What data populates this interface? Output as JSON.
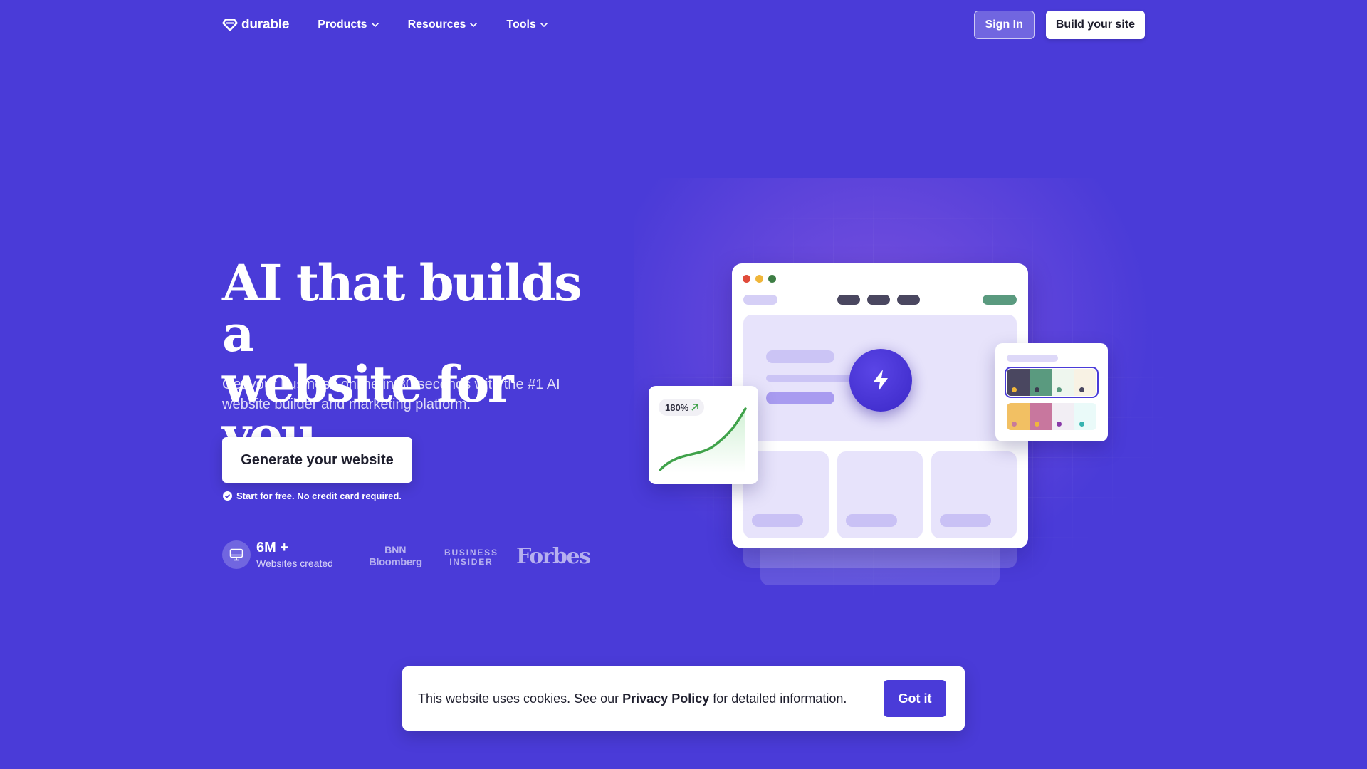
{
  "nav": {
    "logo_text": "durable",
    "items": [
      {
        "label": "Products",
        "icon": "chevron-down-icon"
      },
      {
        "label": "Resources",
        "icon": "chevron-down-icon"
      },
      {
        "label": "Tools",
        "icon": "chevron-down-icon"
      }
    ],
    "sign_in_label": "Sign In",
    "build_label": "Build your site"
  },
  "hero": {
    "title_line1": "AI that builds a",
    "title_line2": "website for you.",
    "subtitle": "Get your business online in 30 seconds with the #1 AI website builder and marketing platform.",
    "cta_label": "Generate your website",
    "cta_note": "Start for free. No credit card required."
  },
  "stats": {
    "number": "6M +",
    "label": "Websites created",
    "icon": "monitor-icon"
  },
  "press": {
    "bnn_line1": "BNN",
    "bnn_line2": "Bloomberg",
    "bi_line1": "BUSINESS",
    "bi_line2": "INSIDER",
    "forbes": "Forbes"
  },
  "illustration": {
    "growth_value": "180%",
    "growth_icon": "arrow-up-right-icon",
    "center_icon": "lightning-bolt-icon"
  },
  "cookie": {
    "text_before": "This website uses cookies. See our ",
    "link_text": "Privacy Policy",
    "text_after": " for detailed information.",
    "button_label": "Got it"
  },
  "colors": {
    "background": "#4a3bd8",
    "accent": "#4a3bd8",
    "card_tint": "#e7e3fb",
    "growth_green": "#3fa24a"
  }
}
